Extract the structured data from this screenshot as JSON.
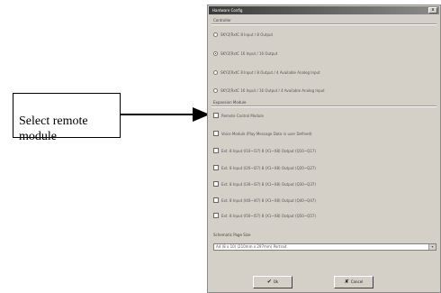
{
  "callout": {
    "text": "Select remote\nmodule"
  },
  "dialog": {
    "title": "Hardware Config",
    "close_label": "x",
    "controller_group": {
      "label": "Controller",
      "options": [
        {
          "label": "SKY2[RxtC 8 Input / 8 Output",
          "selected": false
        },
        {
          "label": "SKY2[RxtC 16 Input / 16 Output",
          "selected": true
        },
        {
          "label": "SKY2[RxtC 8 Input / 8 Output / 4 Available Analog Input",
          "selected": false
        },
        {
          "label": "SKY2[RxtC 16 Input / 16 Output / 4 Available Analog Input",
          "selected": false
        }
      ]
    },
    "expansion_group": {
      "label": "Expansion Module",
      "options": [
        {
          "label": "Remote Control Module",
          "checked": false
        },
        {
          "label": "Voice Module (Play Message Data in user Defined)",
          "checked": false
        },
        {
          "label": "Ext. 8 Input (I10~I17) 8 (X1~X8) Output (Q10~Q17)",
          "checked": false
        },
        {
          "label": "Ext. 8 Input (I20~I27) 8 (X1~X8) Output (Q20~Q27)",
          "checked": false
        },
        {
          "label": "Ext. 8 Input (I30~I37) 8 (X1~X8) Output (Q30~Q37)",
          "checked": false
        },
        {
          "label": "Ext. 8 Input (I40~I47) 8 (X1~X8) Output (Q40~Q47)",
          "checked": false
        },
        {
          "label": "Ext. 8 Input (I50~I57) 8 (X1~X8) Output (Q50~Q57)",
          "checked": false
        }
      ]
    },
    "page_size": {
      "label": "Schematic Page Size",
      "value": "A4 (8 x 10) (210mm x 297mm) Portrait"
    },
    "ok_label": "Ok",
    "cancel_label": "Cancel"
  }
}
